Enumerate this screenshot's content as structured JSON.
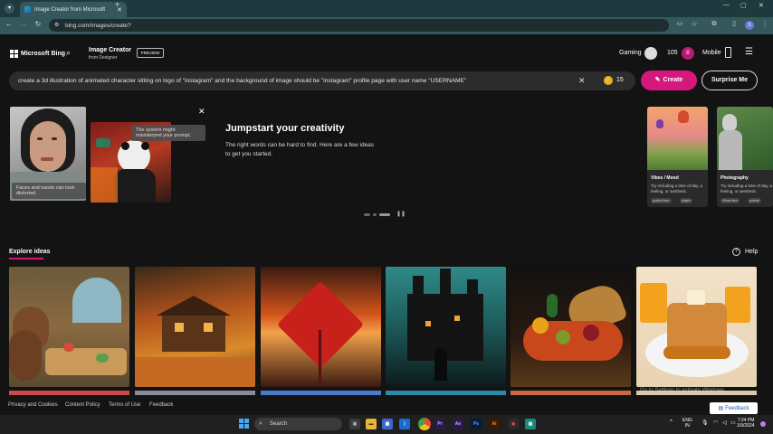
{
  "browser": {
    "tab_title": "Image Creator from Microsoft",
    "url": "bing.com/images/create?"
  },
  "header": {
    "logo": "Microsoft Bing",
    "app_title": "Image Creator",
    "app_subtitle": "from Designer",
    "badge": "PREVIEW",
    "gaming_label": "Gaming",
    "points": "105",
    "mobile_label": "Mobile"
  },
  "prompt": {
    "value": "create a 3d illustration of animated character sitting on logo of \"instagram\" and the background of image should be \"instagram\" profile page with user name \"USERNAME\"",
    "boosts": "15",
    "create_label": "Create",
    "surprise_label": "Surprise Me"
  },
  "hero": {
    "tip1": "Faces and hands can look distorted.",
    "tip2": "The system might misinterpret your prompt.",
    "title": "Jumpstart your creativity",
    "desc": "The right words can be hard to find. Here are a few ideas to get you started.",
    "cards": [
      {
        "title": "Vibes / Mood",
        "desc": "Try including a time of day, a feeling, or aesthetic.",
        "chips": [
          "golden hour",
          "playful"
        ]
      },
      {
        "title": "Photography",
        "desc": "Try including a time of day, a feeling, or aesthetic.",
        "chips": [
          "50mm lens",
          "portrait"
        ]
      }
    ]
  },
  "explore": {
    "label": "Explore ideas",
    "help": "Help"
  },
  "watermark": "Go to Settings to activate Windows.",
  "feedback": "Feedback",
  "footer": {
    "links": [
      "Privacy and Cookies",
      "Content Policy",
      "Terms of Use",
      "Feedback"
    ]
  },
  "taskbar": {
    "search": "Search",
    "lang1": "ENG",
    "lang2": "IN",
    "time": "7:24 PM",
    "date": "1/9/2024"
  },
  "colors": {
    "accent": "#d4187c",
    "tab_bar": "#1f3a3e",
    "page_bg": "#131313"
  }
}
